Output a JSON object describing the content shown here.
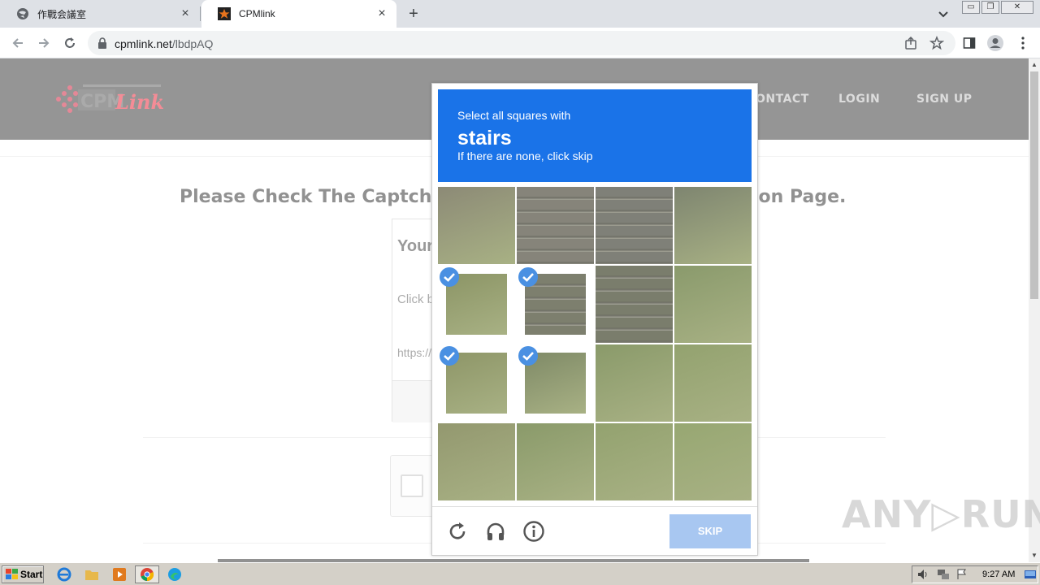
{
  "browser": {
    "tabs": [
      {
        "title": "作戰会議室",
        "active": false
      },
      {
        "title": "CPMlink",
        "active": true
      }
    ],
    "url_domain": "cpmlink.net",
    "url_path": "/lbdpAQ"
  },
  "site": {
    "nav": [
      "ONTACT",
      "LOGIN",
      "SIGN UP"
    ],
    "heading_left": "Please Check The Captcha",
    "heading_right": "ion Page.",
    "card": {
      "title": "Your",
      "text": "Click b",
      "url": "https://"
    }
  },
  "captcha": {
    "line1": "Select all squares with",
    "keyword": "stairs",
    "line2": "If there are none, click skip",
    "skip_label": "SKIP",
    "selected_cells": [
      4,
      5,
      8,
      9
    ]
  },
  "watermark": "ANY▷RUN",
  "taskbar": {
    "start_label": "Start",
    "clock": "9:27 AM"
  }
}
